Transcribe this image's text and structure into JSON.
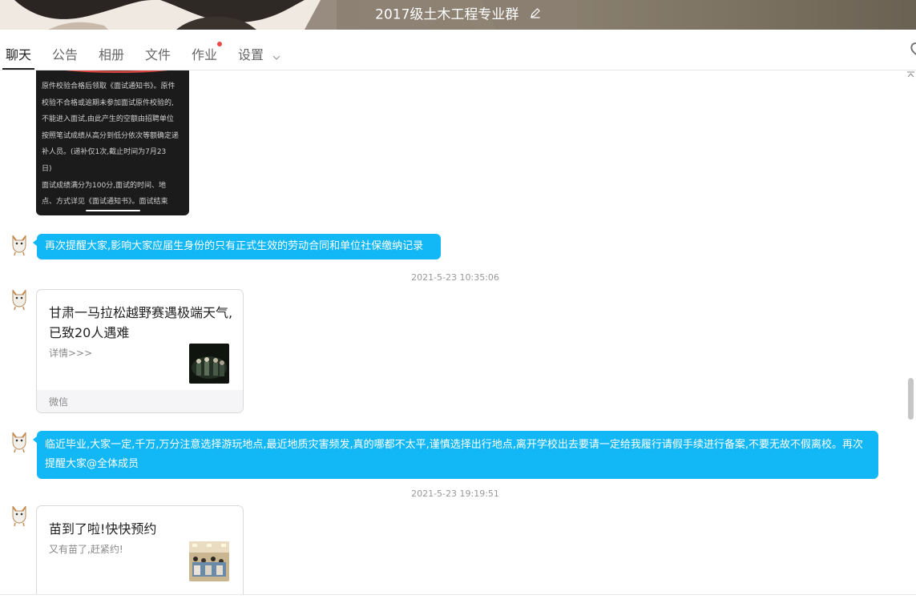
{
  "window": {
    "title": "2017级土木工程专业群"
  },
  "tabs": [
    {
      "label": "聊天"
    },
    {
      "label": "公告"
    },
    {
      "label": "相册"
    },
    {
      "label": "文件"
    },
    {
      "label": "作业"
    },
    {
      "label": "设置"
    }
  ],
  "image_message": {
    "lines": [
      "原件校验合格后领取《面试通知书》。原件",
      "校验不合格或逾期未参加面试原件校验的,",
      "不能进入面试,由此产生的空额由招聘单位",
      "按照笔试成绩从高分到低分依次等额确定递",
      "补人员。(递补仅1次,截止时间为7月23",
      "日)",
      "面试成绩满分为100分,面试的时间、地",
      "点、方式详见《面试通知书》。面试结束"
    ]
  },
  "messages": {
    "m1": {
      "text": "再次提醒大家,影响大家应届生身份的只有正式生效的劳动合同和单位社保缴纳记录"
    },
    "ts1": "2021-5-23 10:35:06",
    "card1": {
      "title": "甘肃一马拉松越野赛遇极端天气,已致20人遇难",
      "desc": "详情>>>",
      "source": "微信"
    },
    "m2": {
      "text": "临近毕业,大家一定,千万,万分注意选择游玩地点,最近地质灾害频发,真的哪都不太平,谨慎选择出行地点,离开学校出去要请一定给我履行请假手续进行备案,不要无故不假离校。再次提醒大家@全体成员"
    },
    "ts2": "2021-5-23 19:19:51",
    "card2": {
      "title": "苗到了啦!快快预约",
      "desc": "又有苗了,赶紧约!"
    }
  },
  "colors": {
    "bubble": "#12b7f5",
    "badge": "#f04646"
  }
}
